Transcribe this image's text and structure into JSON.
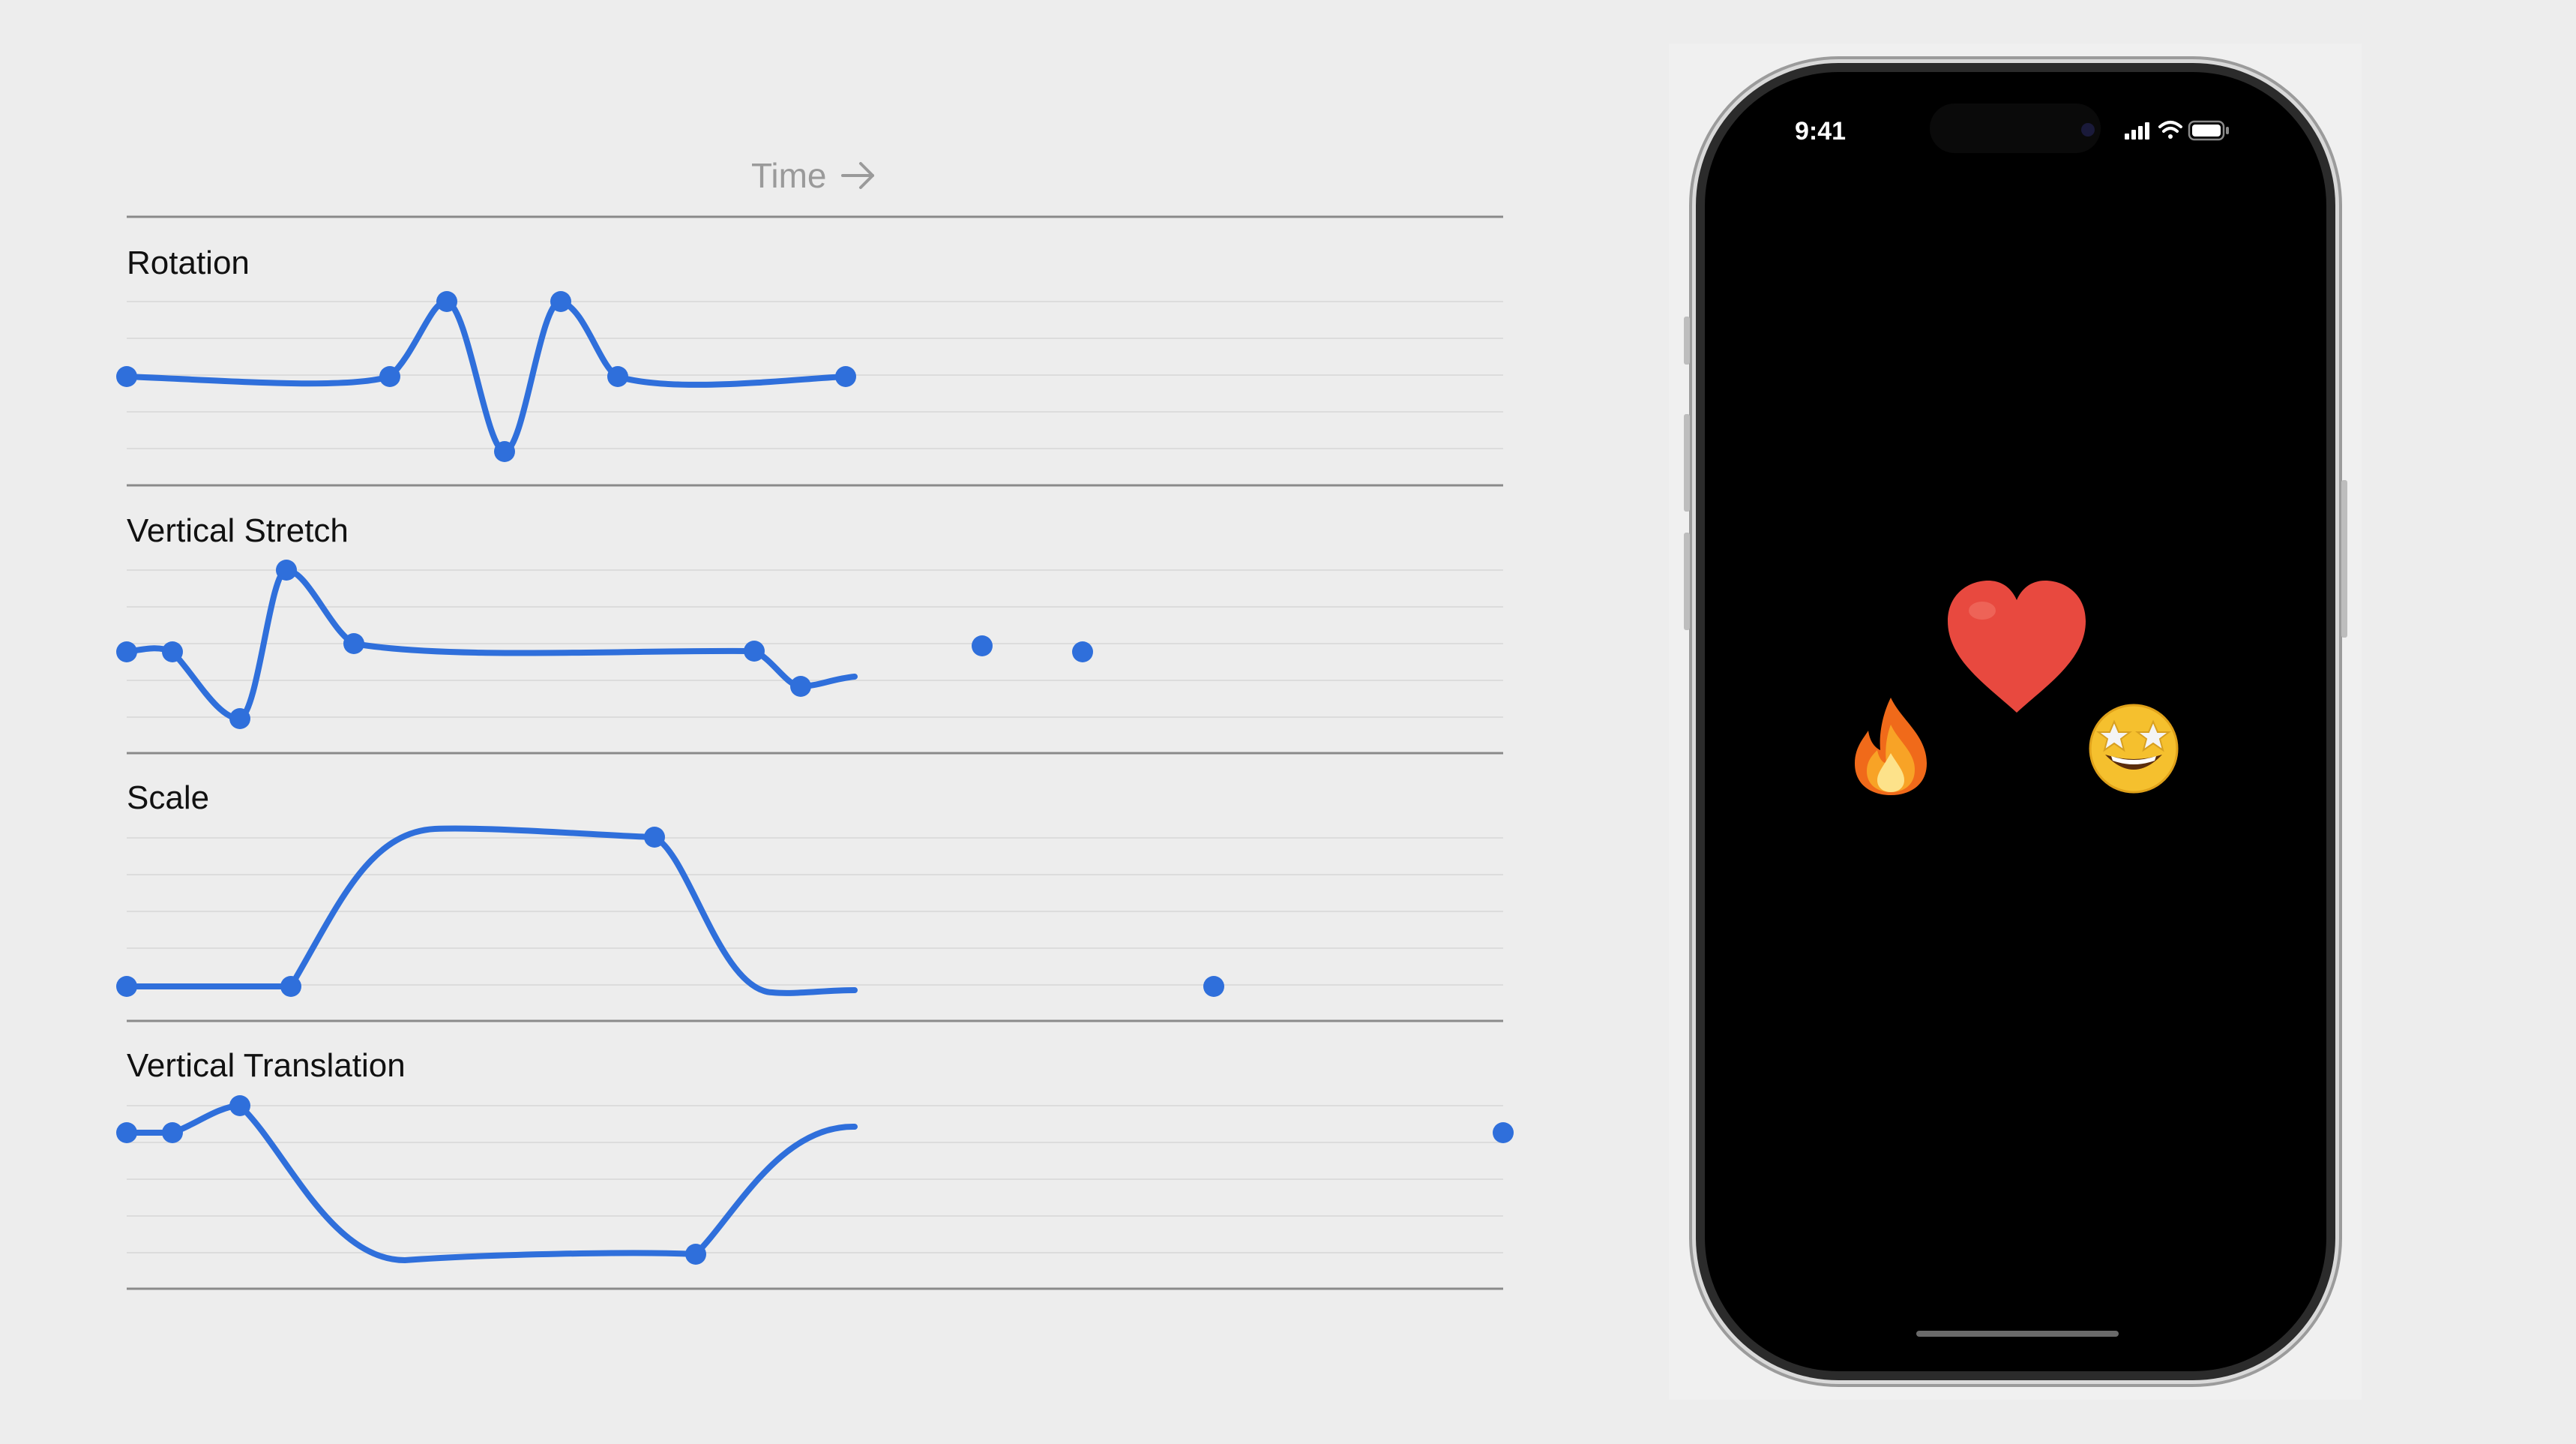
{
  "header": {
    "time_label": "Time",
    "arrow": "→"
  },
  "tracks": [
    {
      "title": "Rotation",
      "color": "#2f6fdb"
    },
    {
      "title": "Vertical Stretch",
      "color": "#2f6fdb"
    },
    {
      "title": "Scale",
      "color": "#2f6fdb"
    },
    {
      "title": "Vertical Translation",
      "color": "#2f6fdb"
    }
  ],
  "phone": {
    "status_time": "9:41",
    "icons": [
      "signal-icon",
      "wifi-icon",
      "battery-icon"
    ],
    "screen_emojis": [
      {
        "name": "heart-emoji",
        "glyph": "heart",
        "color": "#e8493f"
      },
      {
        "name": "fire-emoji",
        "glyph": "fire"
      },
      {
        "name": "star-struck-emoji",
        "glyph": "star-struck",
        "color": "#f5c02e"
      }
    ]
  },
  "colors": {
    "curve": "#2f6fdb",
    "background": "#ededed",
    "gridline": "#dcdcdc",
    "divider": "#8a8a8a"
  }
}
